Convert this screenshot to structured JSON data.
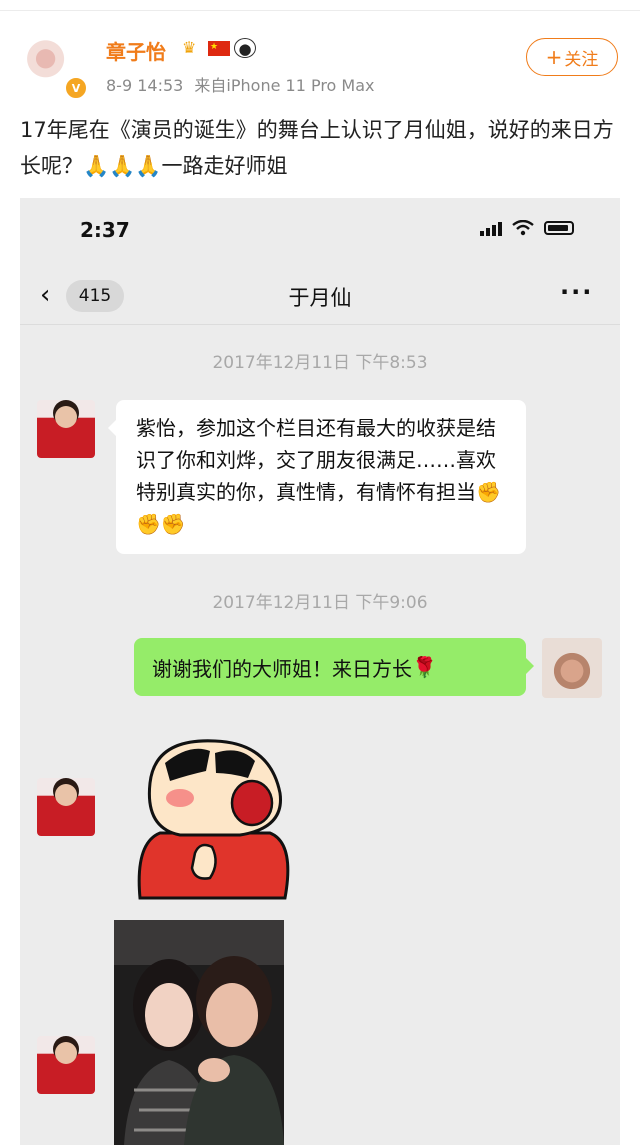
{
  "post": {
    "username": "章子怡",
    "badge_icons": [
      "crown-icon",
      "china-flag-icon",
      "panda-icon"
    ],
    "verified_icon": "verified-v-icon",
    "date": "8-9 14:53",
    "source": "来自iPhone 11 Pro Max",
    "follow_label": "关注",
    "text_before": "17年尾在《演员的诞生》的舞台上认识了月仙姐，说好的来日方长呢？",
    "emoji": "🙏🙏🙏",
    "text_after": "一路走好师姐"
  },
  "screenshot": {
    "status_time": "2:37",
    "nav": {
      "unread_count": "415",
      "title": "于月仙",
      "more": "···"
    },
    "messages": [
      {
        "timestamp": "2017年12月11日 下午8:53"
      },
      {
        "text": "紫怡，参加这个栏目还有最大的收获是结识了你和刘烨，交了朋友很满足……喜欢特别真实的你，真性情，有情怀有担当",
        "emoji": "✊✊✊"
      },
      {
        "timestamp": "2017年12月11日 下午9:06"
      },
      {
        "text": "谢谢我们的大师姐！来日方长",
        "emoji": "🌹"
      }
    ]
  },
  "colors": {
    "username": "#f07c1a",
    "outgoing_bubble": "#95ec69",
    "chat_background": "#ececec"
  }
}
